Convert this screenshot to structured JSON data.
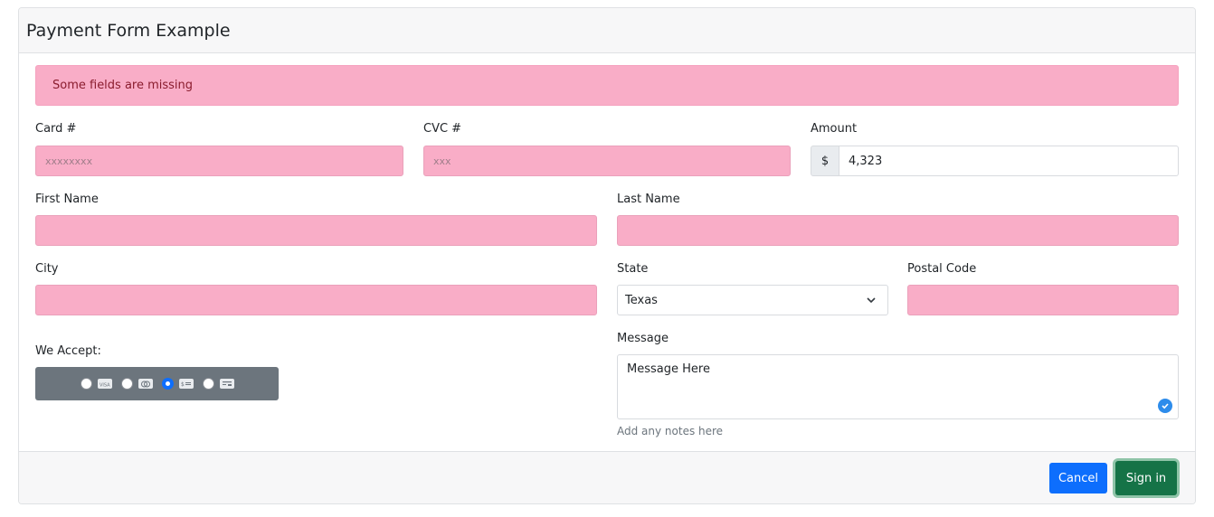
{
  "header": {
    "title": "Payment Form Example"
  },
  "alert": {
    "text": "Some fields are missing"
  },
  "card_number": {
    "label": "Card #",
    "placeholder": "xxxxxxxx"
  },
  "cvc": {
    "label": "CVC #",
    "placeholder": "xxx"
  },
  "amount": {
    "label": "Amount",
    "prefix": "$",
    "value": "4,323"
  },
  "first_name": {
    "label": "First Name",
    "value": ""
  },
  "last_name": {
    "label": "Last Name",
    "value": ""
  },
  "city": {
    "label": "City",
    "value": ""
  },
  "state": {
    "label": "State",
    "selected": "Texas"
  },
  "postal_code": {
    "label": "Postal Code",
    "value": ""
  },
  "accept": {
    "label": "We Accept:",
    "options": [
      {
        "icon": "visa-card-icon",
        "checked": false
      },
      {
        "icon": "mastercard-icon",
        "checked": false
      },
      {
        "icon": "money-card-icon",
        "checked": true
      },
      {
        "icon": "generic-card-icon",
        "checked": false
      }
    ]
  },
  "message": {
    "label": "Message",
    "value": "Message Here",
    "hint": "Add any notes here"
  },
  "footer": {
    "cancel_label": "Cancel",
    "signin_label": "Sign in"
  },
  "colors": {
    "invalid_bg": "#f9adc7",
    "primary": "#0d6efd",
    "success": "#157347",
    "accept_bg": "#6c757d"
  }
}
